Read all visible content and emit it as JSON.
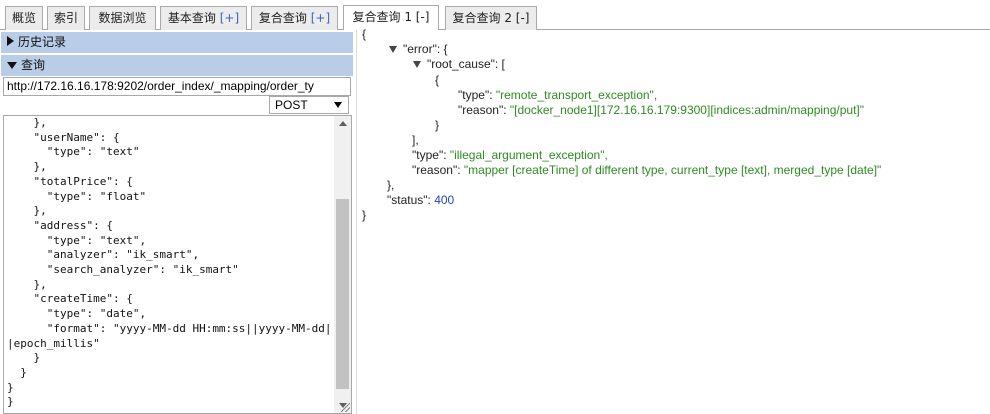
{
  "tabs": [
    {
      "label": "概览"
    },
    {
      "label": "索引"
    },
    {
      "label": "数据浏览"
    },
    {
      "label": "基本查询",
      "action": "[+]"
    },
    {
      "label": "复合查询",
      "action": "[+]"
    },
    {
      "label": "复合查询 1",
      "action": "[-]"
    },
    {
      "label": "复合查询 2",
      "action": "[-]"
    }
  ],
  "left": {
    "history_label": "历史记录",
    "query_label": "查询",
    "url_value": "http://172.16.16.178:9202/order_index/_mapping/order_ty",
    "method": "POST",
    "body_text": "    },\n    \"userName\": {\n      \"type\": \"text\"\n    },\n    \"totalPrice\": {\n      \"type\": \"float\"\n    },\n    \"address\": {\n      \"type\": \"text\",\n      \"analyzer\": \"ik_smart\",\n      \"search_analyzer\": \"ik_smart\"\n    },\n    \"createTime\": {\n      \"type\": \"date\",\n      \"format\": \"yyyy-MM-dd HH:mm:ss||yyyy-MM-dd||epoch_millis\"\n    }\n  }\n}\n}"
  },
  "result": {
    "open_brace": "{",
    "error_key": "\"error\": {",
    "root_cause_key": "\"root_cause\": [",
    "item_open": "{",
    "rc_type_key": "\"type\": ",
    "rc_type_val": "\"remote_transport_exception\",",
    "rc_reason_key": "\"reason\": ",
    "rc_reason_val": "\"[docker_node1][172.16.16.179:9300][indices:admin/mapping/put]\"",
    "item_close": "}",
    "array_close": "],",
    "type_key": "\"type\": ",
    "type_val": "\"illegal_argument_exception\",",
    "reason_key": "\"reason\": ",
    "reason_val": "\"mapper [createTime] of different type, current_type [text], merged_type [date]\"",
    "error_close": "},",
    "status_key": "\"status\": ",
    "status_val": "400",
    "close_brace": "}"
  },
  "colors": {
    "header_bg": "#b9cce8",
    "string": "#2e8b22",
    "number": "#2146b8",
    "tab_action": "#3a62c5"
  },
  "icons": {
    "collapsed": "triangle-right",
    "expanded": "triangle-down"
  }
}
